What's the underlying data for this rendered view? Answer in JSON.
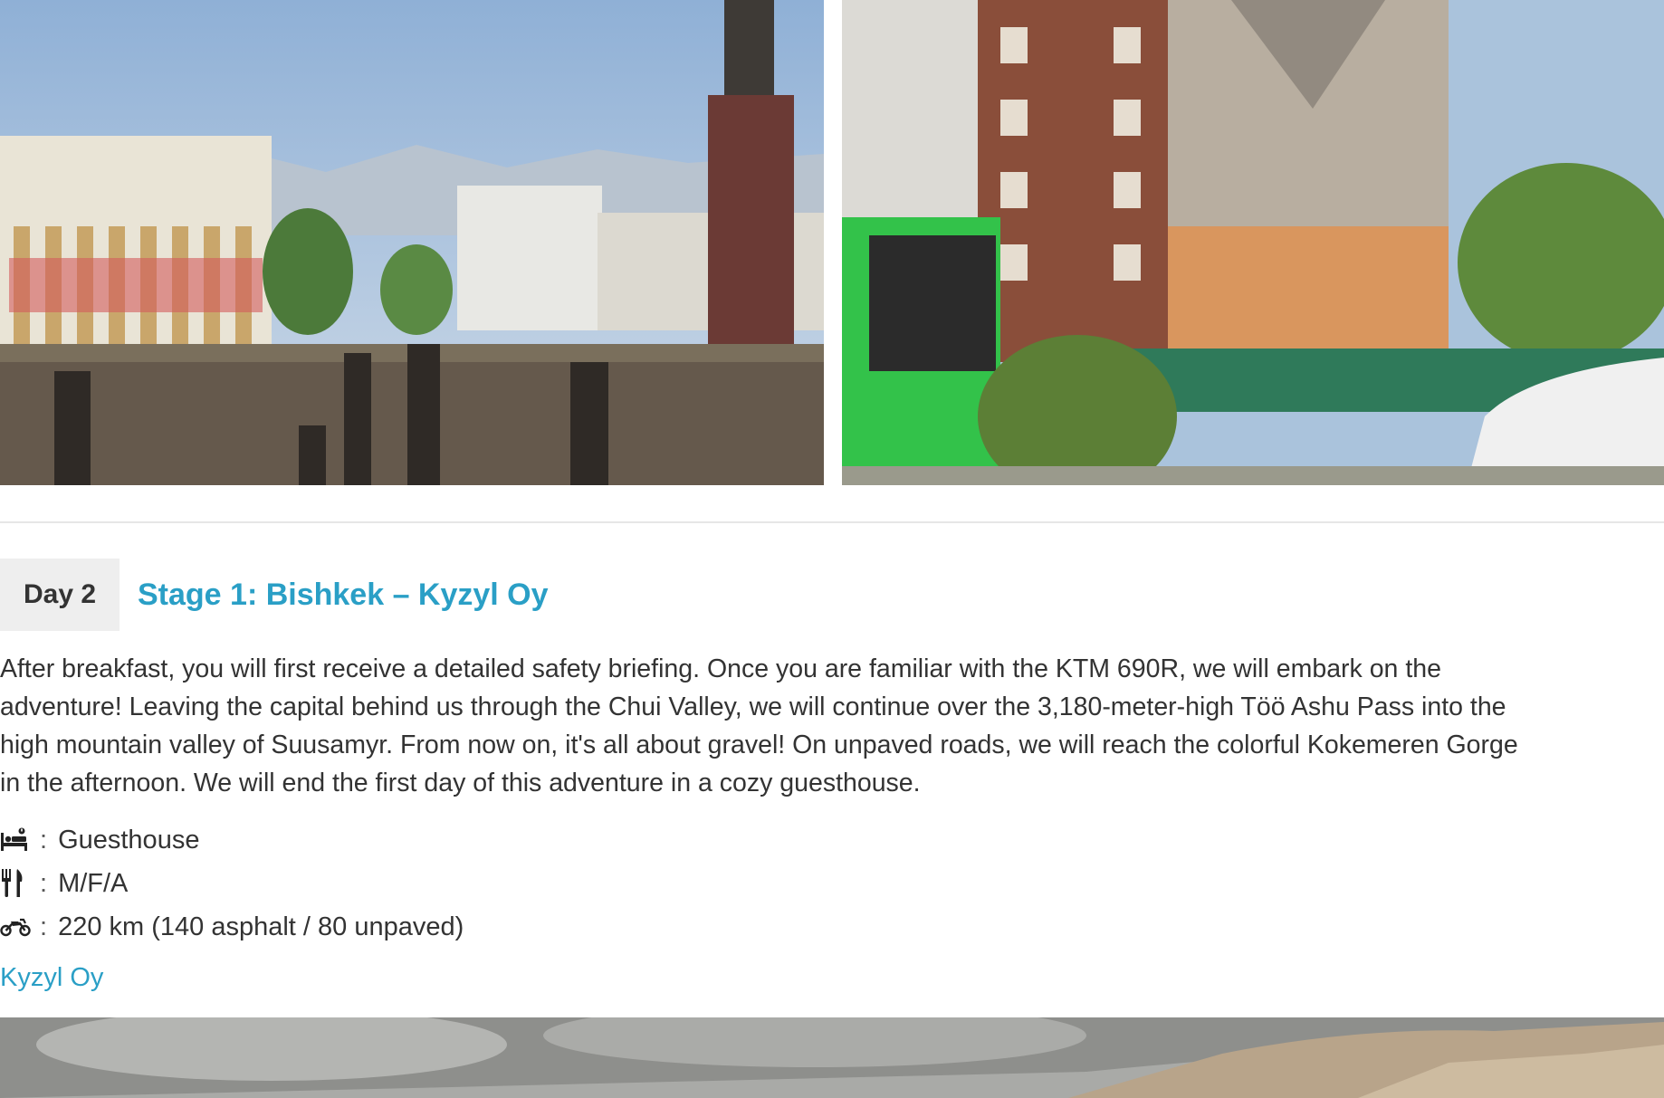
{
  "day": {
    "badge": "Day 2",
    "title": "Stage 1: Bishkek – Kyzyl Oy",
    "description": "After breakfast, you will first receive a detailed safety briefing. Once you are familiar with the KTM 690R, we will embark on the\nadventure! Leaving the capital behind us through the Chui Valley, we will continue over the 3,180-meter-high Töö Ashu Pass into the\nhigh mountain valley of Suusamyr. From now on, it's all about gravel! On unpaved roads, we will reach the colorful Kokemeren Gorge\nin the afternoon. We will end the first day of this adventure in a cozy guesthouse.",
    "info": [
      {
        "icon": "bed-icon",
        "separator": ":",
        "value": "Guesthouse"
      },
      {
        "icon": "utensils-icon",
        "separator": ":",
        "value": "M/F/A"
      },
      {
        "icon": "motorcycle-icon",
        "separator": ":",
        "value": "220 km (140 asphalt / 80 unpaved)"
      }
    ],
    "place_link": "Kyzyl Oy"
  },
  "colors": {
    "accent": "#2a9fc6",
    "badge_bg": "#eeeeee",
    "text": "#333333"
  }
}
